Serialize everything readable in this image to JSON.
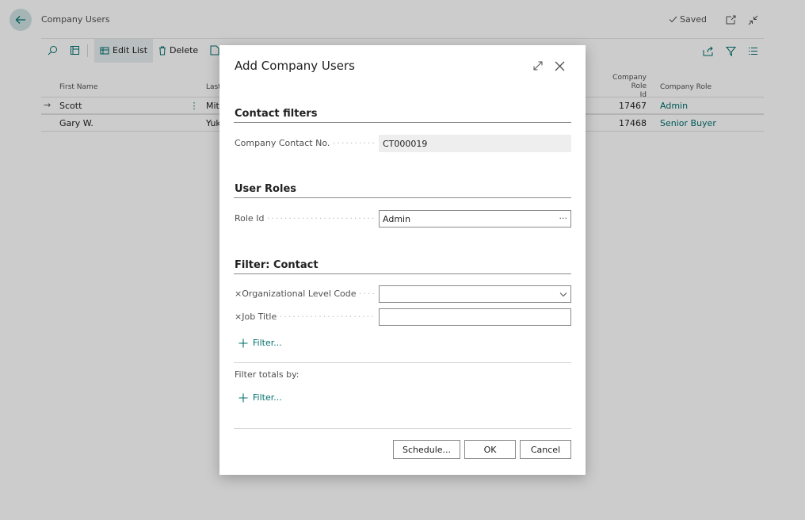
{
  "page": {
    "title": "Company Users",
    "saved_label": "Saved",
    "toolbar": {
      "edit_list_label": "Edit List",
      "delete_label": "Delete"
    },
    "grid": {
      "columns": {
        "first_name": "First Name",
        "last_name": "Last",
        "company_role_id_line1": "Company Role",
        "company_role_id_line2": "Id",
        "company_role": "Company Role"
      },
      "rows": [
        {
          "first_name": "Scott",
          "last_name": "Mit",
          "company_role_id": "17467",
          "company_role": "Admin"
        },
        {
          "first_name": "Gary W.",
          "last_name": "Yuk",
          "company_role_id": "17468",
          "company_role": "Senior Buyer"
        }
      ]
    }
  },
  "dialog": {
    "title": "Add Company Users",
    "sections": {
      "contact_filters": {
        "title": "Contact filters",
        "company_contact_label": "Company Contact No.",
        "company_contact_value": "CT000019"
      },
      "user_roles": {
        "title": "User Roles",
        "role_id_label": "Role Id",
        "role_id_value": "Admin"
      },
      "filter_contact": {
        "title": "Filter: Contact",
        "org_level_label": "Organizational Level Code",
        "org_level_value": "",
        "job_title_label": "Job Title",
        "job_title_value": "",
        "filter_link": "Filter..."
      },
      "filter_totals": {
        "label": "Filter totals by:",
        "filter_link": "Filter..."
      }
    },
    "buttons": {
      "schedule": "Schedule...",
      "ok": "OK",
      "cancel": "Cancel"
    }
  },
  "colors": {
    "accent": "#00706d",
    "overlay": "#000000"
  }
}
